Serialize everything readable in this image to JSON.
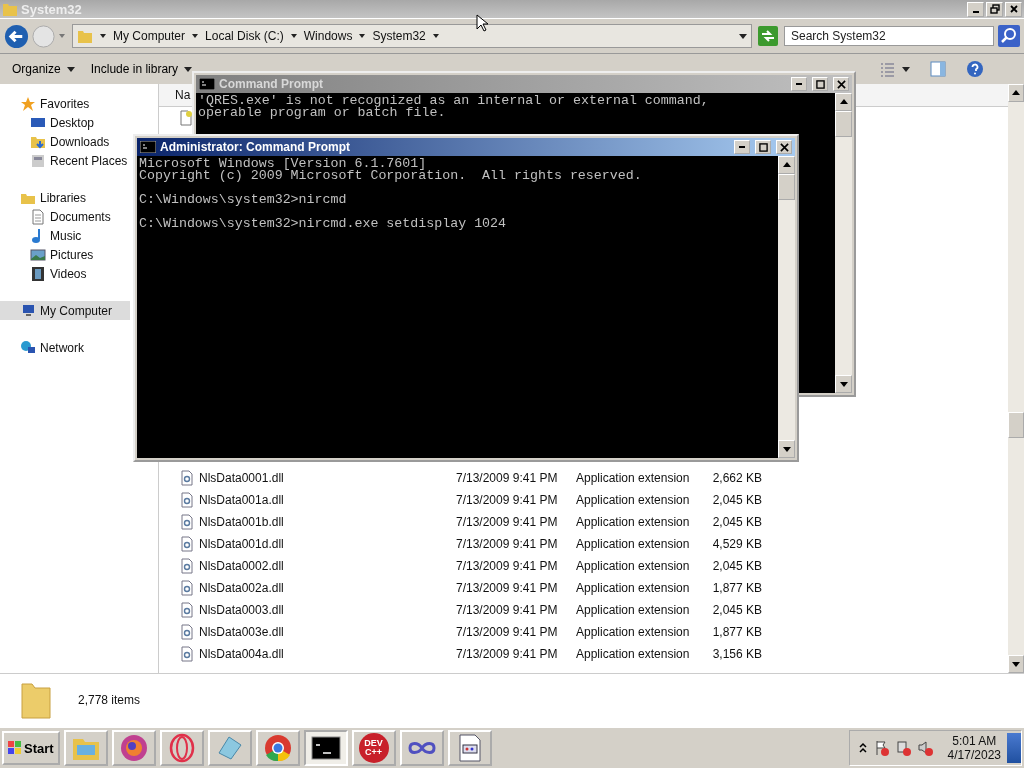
{
  "explorer": {
    "title": "System32",
    "breadcrumb": [
      "My Computer",
      "Local Disk (C:)",
      "Windows",
      "System32"
    ],
    "search_placeholder": "Search System32",
    "toolbar": [
      "Organize",
      "Include in library"
    ],
    "sidebar": [
      {
        "label": "Favorites",
        "kind": "star",
        "selected": false,
        "children": [
          {
            "label": "Desktop",
            "kind": "desktop",
            "selected": false
          },
          {
            "label": "Downloads",
            "kind": "downloads",
            "selected": false
          },
          {
            "label": "Recent Places",
            "kind": "recent",
            "selected": false
          }
        ]
      },
      {
        "label": "Libraries",
        "kind": "library",
        "selected": false,
        "children": [
          {
            "label": "Documents",
            "kind": "document",
            "selected": false
          },
          {
            "label": "Music",
            "kind": "music",
            "selected": false
          },
          {
            "label": "Pictures",
            "kind": "pictures",
            "selected": false
          },
          {
            "label": "Videos",
            "kind": "videos",
            "selected": false
          }
        ]
      },
      {
        "label": "My Computer",
        "kind": "computer",
        "selected": true
      },
      {
        "label": "Network",
        "kind": "network",
        "selected": false
      }
    ],
    "column_header": "Na",
    "files": [
      {
        "name": "NlsData0001.dll",
        "date": "7/13/2009 9:41 PM",
        "type": "Application extension",
        "size": "2,662 KB"
      },
      {
        "name": "NlsData001a.dll",
        "date": "7/13/2009 9:41 PM",
        "type": "Application extension",
        "size": "2,045 KB"
      },
      {
        "name": "NlsData001b.dll",
        "date": "7/13/2009 9:41 PM",
        "type": "Application extension",
        "size": "2,045 KB"
      },
      {
        "name": "NlsData001d.dll",
        "date": "7/13/2009 9:41 PM",
        "type": "Application extension",
        "size": "4,529 KB"
      },
      {
        "name": "NlsData0002.dll",
        "date": "7/13/2009 9:41 PM",
        "type": "Application extension",
        "size": "2,045 KB"
      },
      {
        "name": "NlsData002a.dll",
        "date": "7/13/2009 9:41 PM",
        "type": "Application extension",
        "size": "1,877 KB"
      },
      {
        "name": "NlsData0003.dll",
        "date": "7/13/2009 9:41 PM",
        "type": "Application extension",
        "size": "2,045 KB"
      },
      {
        "name": "NlsData003e.dll",
        "date": "7/13/2009 9:41 PM",
        "type": "Application extension",
        "size": "1,877 KB"
      },
      {
        "name": "NlsData004a.dll",
        "date": "7/13/2009 9:41 PM",
        "type": "Application extension",
        "size": "3,156 KB"
      }
    ],
    "status": "2,778 items"
  },
  "consoles": [
    {
      "title": "Command Prompt",
      "active": false,
      "blocks": [
        [
          "'QRES.exe' is not recognized as an internal or external command,",
          "operable program or batch file."
        ]
      ]
    },
    {
      "title": "Administrator: Command Prompt",
      "active": true,
      "blocks": [
        [
          "Microsoft Windows [Version 6.1.7601]",
          "Copyright (c) 2009 Microsoft Corporation.  All rights reserved."
        ],
        [
          "C:\\Windows\\system32>nircmd"
        ],
        [
          "C:\\Windows\\system32>nircmd.exe setdisplay 1024"
        ]
      ]
    }
  ],
  "taskbar": {
    "start": "Start",
    "apps": [
      {
        "kind": "explorer",
        "selected": false
      },
      {
        "kind": "swirl",
        "selected": false
      },
      {
        "kind": "ring",
        "selected": false
      },
      {
        "kind": "notepad",
        "selected": false
      },
      {
        "kind": "chrome",
        "selected": false
      },
      {
        "kind": "console",
        "selected": true
      },
      {
        "kind": "devcpp",
        "label": "DEV C++",
        "selected": false
      },
      {
        "kind": "infinity",
        "selected": false
      },
      {
        "kind": "window",
        "selected": false
      }
    ],
    "time": "5:01 AM",
    "date": "4/17/2023"
  }
}
